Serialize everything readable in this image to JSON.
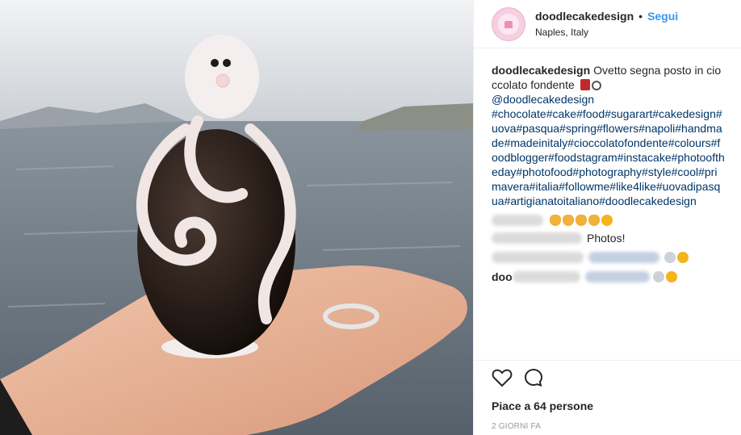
{
  "post": {
    "username": "doodlecakedesign",
    "follow_label": "Segui",
    "separator": "•",
    "location": "Naples, Italy"
  },
  "caption": {
    "username": "doodlecakedesign",
    "text": "Ovetto segna posto in cioccolato fondente",
    "mention": "@doodlecakedesign",
    "hashtags": "#chocolate#cake#food#sugarart#cakedesign#uova#pasqua#spring#flowers#napoli#handmade#madeinitaly#cioccolatofondente#colours#foodblogger#foodstagram#instacake#photooftheday#photofood#photography#style#cool#primavera#italia#followme#like4like#uovadipasqua#artigianatoitaliano#doodlecakedesign"
  },
  "comments": [
    {
      "text": "",
      "emoji": [
        "clap-emoji",
        "clap-emoji",
        "ok-hand-emoji",
        "ok-hand-emoji",
        "kiss-emoji"
      ]
    },
    {
      "text": "Photos!",
      "emoji": []
    },
    {
      "text": "",
      "emoji": [
        "pray-emoji",
        "smile-emoji"
      ]
    },
    {
      "text": "doo",
      "emoji": [
        "pray-emoji",
        "grin-emoji"
      ]
    }
  ],
  "actions": {
    "likes": "Piace a 64 persone",
    "time": "2 GIORNI FA"
  },
  "colors": {
    "link": "#3897f0",
    "hashtag": "#003569",
    "timestamp": "#999999"
  }
}
